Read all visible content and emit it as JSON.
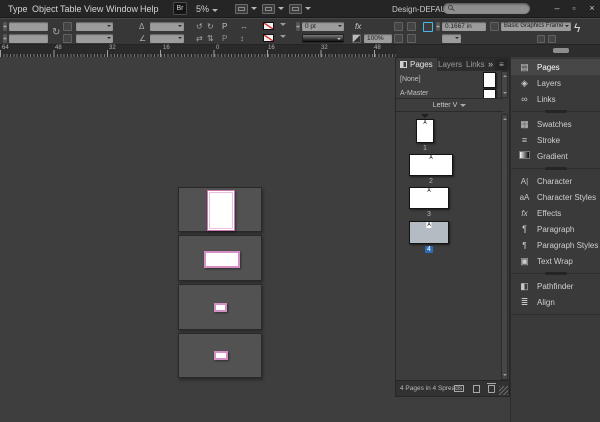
{
  "menubar": {
    "items": [
      "Type",
      "Object",
      "Table",
      "View",
      "Window",
      "Help"
    ],
    "bridge_label": "Br",
    "zoom_value": "5%",
    "workspace_label": "Design-DEFAULT"
  },
  "window_controls": {
    "minimize": "–",
    "maximize": "▫",
    "close": "×"
  },
  "control_panel": {
    "rotate_label": "P",
    "stroke_weight": "0 pt",
    "opacity": "100%",
    "fx_label": "fx",
    "corner_radius": "0.1667 in",
    "object_style": "Basic Graphics Frame",
    "lightning": "ϟ"
  },
  "ruler": {
    "labels": [
      "64",
      "48",
      "32",
      "16",
      "0",
      "16",
      "32",
      "48"
    ]
  },
  "pages_panel": {
    "tabs": [
      {
        "label": "Pages"
      },
      {
        "label": "Layers"
      },
      {
        "label": "Links"
      }
    ],
    "collapse_glyph": "»",
    "menu_glyph": "≡",
    "masters": [
      {
        "name": "[None]"
      },
      {
        "name": "A-Master"
      }
    ],
    "size_preset": "Letter V",
    "pages": [
      {
        "number": "1",
        "master": "A"
      },
      {
        "number": "2",
        "master": "A"
      },
      {
        "number": "3",
        "master": "A"
      },
      {
        "number": "4",
        "master": "A"
      }
    ],
    "status": "4 Pages in 4 Spreads"
  },
  "dock": {
    "groups": [
      {
        "items": [
          {
            "label": "Pages",
            "icon": "▤"
          },
          {
            "label": "Layers",
            "icon": "◈"
          },
          {
            "label": "Links",
            "icon": "∞"
          }
        ]
      },
      {
        "items": [
          {
            "label": "Swatches",
            "icon": "▦"
          },
          {
            "label": "Stroke",
            "icon": "≡"
          },
          {
            "label": "Gradient",
            "icon": ""
          }
        ]
      },
      {
        "items": [
          {
            "label": "Character",
            "icon": "A|"
          },
          {
            "label": "Character Styles",
            "icon": "aA"
          },
          {
            "label": "Effects",
            "icon": "fx"
          },
          {
            "label": "Paragraph",
            "icon": "¶"
          },
          {
            "label": "Paragraph Styles",
            "icon": "¶"
          },
          {
            "label": "Text Wrap",
            "icon": "▣"
          }
        ]
      },
      {
        "items": [
          {
            "label": "Pathfinder",
            "icon": "◧"
          },
          {
            "label": "Align",
            "icon": "≣"
          }
        ]
      }
    ]
  },
  "colors": {
    "selection_blue": "#2f6cb3",
    "guide_pink": "#c976b4",
    "none_red": "#cf3226",
    "corner_focus_blue": "#49b8f0"
  }
}
